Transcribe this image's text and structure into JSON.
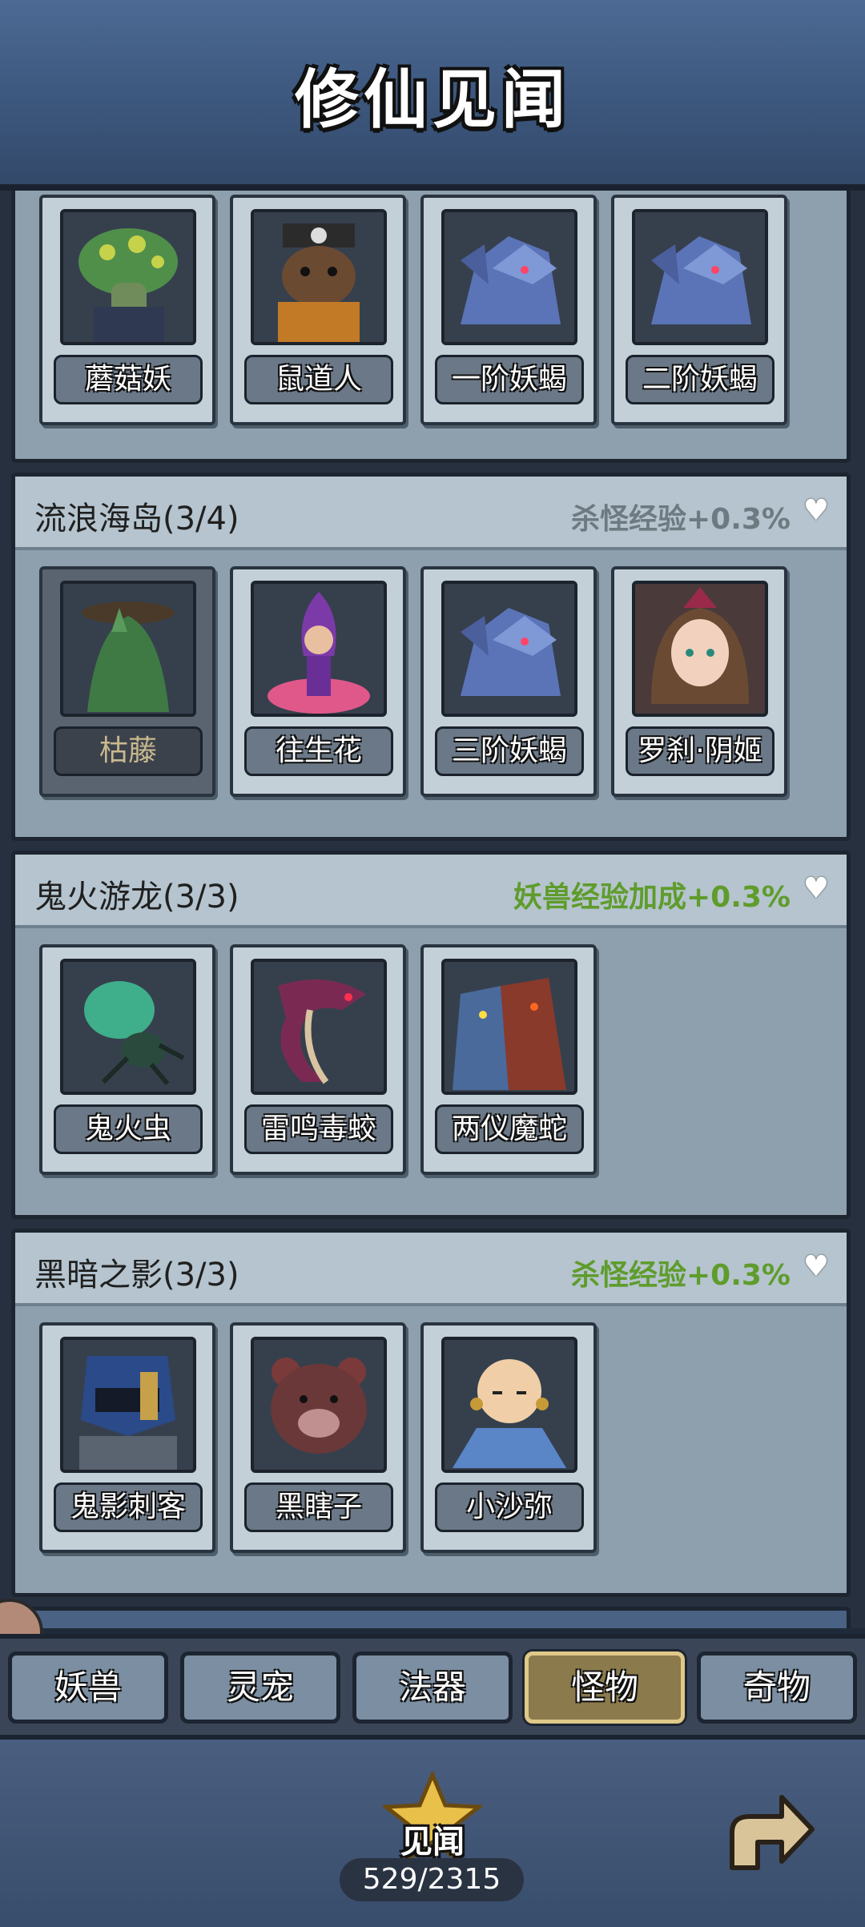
{
  "header": {
    "title": "修仙见闻"
  },
  "sections": [
    {
      "name": "",
      "bonus": "",
      "cards": [
        {
          "label": "蘑菇妖",
          "icon": "mushroom-demon"
        },
        {
          "label": "鼠道人",
          "icon": "rat-taoist"
        },
        {
          "label": "一阶妖蝎",
          "icon": "blue-scorpion"
        },
        {
          "label": "二阶妖蝎",
          "icon": "blue-scorpion"
        }
      ]
    },
    {
      "name": "流浪海岛(3/4)",
      "bonus": "杀怪经验+0.3%",
      "bonus_color": "#6e7a82",
      "cards": [
        {
          "label": "枯藤",
          "icon": "withered-vine",
          "locked": true
        },
        {
          "label": "往生花",
          "icon": "rebirth-flower"
        },
        {
          "label": "三阶妖蝎",
          "icon": "blue-scorpion"
        },
        {
          "label": "罗刹·阴姬",
          "icon": "rakshasa-maiden"
        }
      ]
    },
    {
      "name": "鬼火游龙(3/3)",
      "bonus": "妖兽经验加成+0.3%",
      "bonus_color": "#5f9c2c",
      "cards": [
        {
          "label": "鬼火虫",
          "icon": "ghostfire-bug"
        },
        {
          "label": "雷鸣毒蛟",
          "icon": "thunder-dragon"
        },
        {
          "label": "两仪魔蛇",
          "icon": "twin-serpent"
        }
      ]
    },
    {
      "name": "黑暗之影(3/3)",
      "bonus": "杀怪经验+0.3%",
      "bonus_color": "#5f9c2c",
      "cards": [
        {
          "label": "鬼影刺客",
          "icon": "shadow-assassin"
        },
        {
          "label": "黑瞎子",
          "icon": "black-bear"
        },
        {
          "label": "小沙弥",
          "icon": "young-monk"
        }
      ]
    }
  ],
  "tabs": [
    {
      "label": "妖兽",
      "active": false
    },
    {
      "label": "灵宠",
      "active": false
    },
    {
      "label": "法器",
      "active": false
    },
    {
      "label": "怪物",
      "active": true
    },
    {
      "label": "奇物",
      "active": false
    }
  ],
  "footer": {
    "star_label": "见闻",
    "progress": "529/2315",
    "return_icon": "return-arrow-icon"
  },
  "colors": {
    "accent_gold": "#e8c04a",
    "green_bonus": "#5f9c2c"
  }
}
